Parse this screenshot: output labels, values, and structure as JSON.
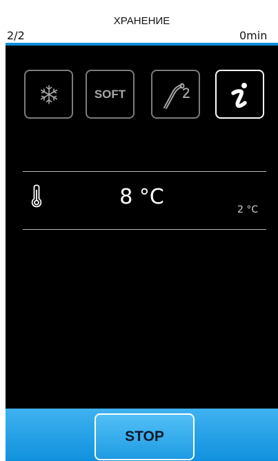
{
  "header": {
    "title": "ХРАНЕНИЕ",
    "page_indicator": "2/2",
    "time": "0min"
  },
  "modes": [
    {
      "name": "freeze",
      "icon": "snowflake-icon",
      "active": false
    },
    {
      "name": "soft",
      "label": "SOFT",
      "active": false
    },
    {
      "name": "probe",
      "icon": "core-probe-icon",
      "active": false
    },
    {
      "name": "info",
      "icon": "info-icon",
      "active": true
    }
  ],
  "temperature": {
    "icon": "thermometer-icon",
    "current": "8 °C",
    "setpoint": "2 °C"
  },
  "footer": {
    "stop_label": "STOP"
  },
  "colors": {
    "accent": "#1797e0",
    "background": "#000000",
    "inactive_border": "#7d7d7d",
    "active_border": "#ffffff"
  }
}
